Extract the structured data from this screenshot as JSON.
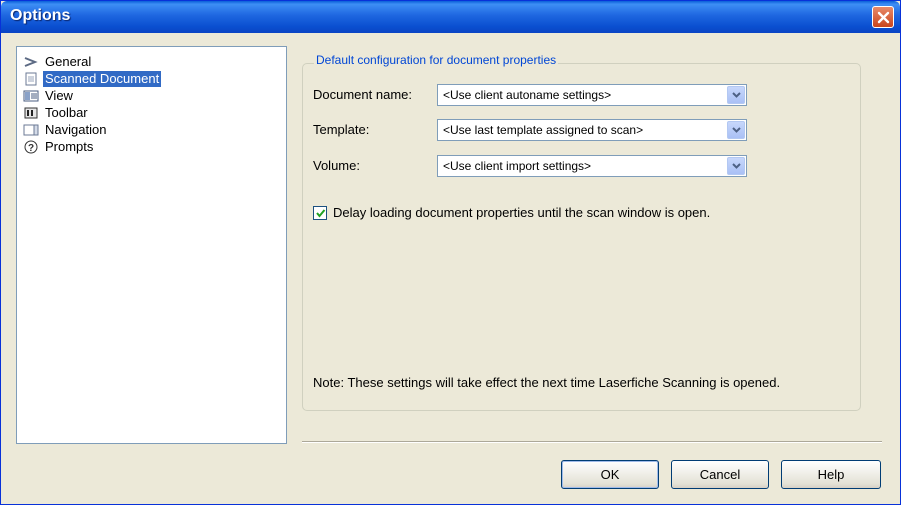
{
  "window": {
    "title": "Options"
  },
  "nav": {
    "items": [
      {
        "label": "General",
        "icon": "chevron-right-icon",
        "selected": false
      },
      {
        "label": "Scanned Document",
        "icon": "document-icon",
        "selected": true
      },
      {
        "label": "View",
        "icon": "view-icon",
        "selected": false
      },
      {
        "label": "Toolbar",
        "icon": "toolbar-icon",
        "selected": false
      },
      {
        "label": "Navigation",
        "icon": "navigation-icon",
        "selected": false
      },
      {
        "label": "Prompts",
        "icon": "help-icon",
        "selected": false
      }
    ]
  },
  "group": {
    "legend": "Default configuration for document properties",
    "fields": [
      {
        "label": "Document name:",
        "value": "<Use client autoname settings>"
      },
      {
        "label": "Template:",
        "value": "<Use last template assigned to scan>"
      },
      {
        "label": "Volume:",
        "value": "<Use client import settings>"
      }
    ],
    "delay_checkbox": {
      "label": "Delay loading document properties until the scan window is open.",
      "checked": true
    },
    "note": "Note: These settings will take effect the next time Laserfiche Scanning is opened."
  },
  "buttons": {
    "ok": "OK",
    "cancel": "Cancel",
    "help": "Help"
  },
  "colors": {
    "titlebar": "#0a5fd8",
    "selection": "#316ac5",
    "legend": "#0046d5"
  }
}
